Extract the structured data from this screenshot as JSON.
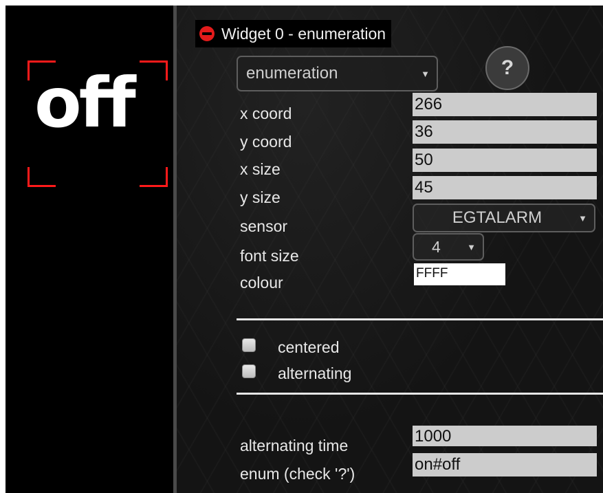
{
  "preview": {
    "text": "off",
    "frame_color": "#ff1a1a"
  },
  "widget": {
    "header_title": "Widget 0 - enumeration",
    "type_select": "enumeration",
    "help_label": "?"
  },
  "fields": {
    "x_coord": {
      "label": "x coord",
      "value": "266"
    },
    "y_coord": {
      "label": "y coord",
      "value": "36"
    },
    "x_size": {
      "label": "x size",
      "value": "50"
    },
    "y_size": {
      "label": "y size",
      "value": "45"
    },
    "sensor": {
      "label": "sensor",
      "value": "EGTALARM"
    },
    "font_size": {
      "label": "font size",
      "value": "4"
    },
    "colour": {
      "label": "colour",
      "value": "FFFF"
    }
  },
  "options": {
    "centered": {
      "label": "centered",
      "checked": false
    },
    "alternating": {
      "label": "alternating",
      "checked": false
    }
  },
  "extra": {
    "alternating_time": {
      "label": "alternating time",
      "value": "1000"
    },
    "enum": {
      "label": "enum (check '?')",
      "value": "on#off"
    }
  },
  "icons": {
    "remove": "minus-circle-icon",
    "dropdown": "triangle-down-icon"
  },
  "colors": {
    "remove_icon": "#e31b1b",
    "field_bg": "#cccccc",
    "colour_field_bg": "#ffffff"
  }
}
